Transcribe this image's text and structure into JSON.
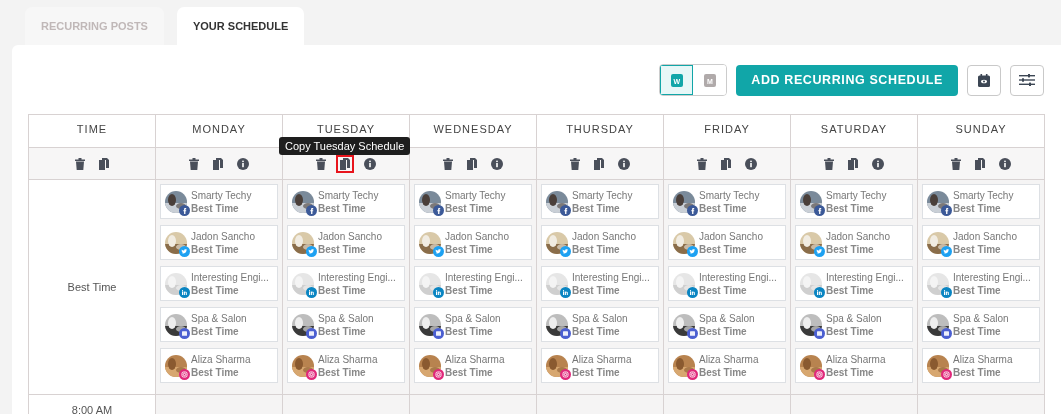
{
  "tabs": [
    {
      "label": "RECURRING POSTS",
      "selected": false
    },
    {
      "label": "YOUR SCHEDULE",
      "selected": true
    }
  ],
  "view_toggle": [
    {
      "label": "W",
      "selected": true
    },
    {
      "label": "M",
      "selected": false
    }
  ],
  "add_button": "ADD RECURRING SCHEDULE",
  "time_header": "TIME",
  "days": [
    {
      "label": "MONDAY",
      "copy_highlighted": false
    },
    {
      "label": "TUESDAY",
      "copy_highlighted": true,
      "tooltip": "Copy Tuesday Schedule"
    },
    {
      "label": "WEDNESDAY",
      "copy_highlighted": false
    },
    {
      "label": "THURSDAY",
      "copy_highlighted": false
    },
    {
      "label": "FRIDAY",
      "copy_highlighted": false
    },
    {
      "label": "SATURDAY",
      "copy_highlighted": false
    },
    {
      "label": "SUNDAY",
      "copy_highlighted": false
    }
  ],
  "rows": [
    {
      "time": "Best Time",
      "cells": [
        [
          {
            "name": "Smarty Techy",
            "kind": "facebook",
            "slot": "Best Time"
          },
          {
            "name": "Jadon Sancho",
            "kind": "twitter",
            "slot": "Best Time"
          },
          {
            "name": "Interesting Engi...",
            "kind": "linkedin",
            "slot": "Best Time"
          },
          {
            "name": "Spa & Salon",
            "kind": "business",
            "slot": "Best Time"
          },
          {
            "name": "Aliza Sharma",
            "kind": "instagram",
            "slot": "Best Time"
          }
        ],
        [
          {
            "name": "Smarty Techy",
            "kind": "facebook",
            "slot": "Best Time"
          },
          {
            "name": "Jadon Sancho",
            "kind": "twitter",
            "slot": "Best Time"
          },
          {
            "name": "Interesting Engi...",
            "kind": "linkedin",
            "slot": "Best Time"
          },
          {
            "name": "Spa & Salon",
            "kind": "business",
            "slot": "Best Time"
          },
          {
            "name": "Aliza Sharma",
            "kind": "instagram",
            "slot": "Best Time"
          }
        ],
        [
          {
            "name": "Smarty Techy",
            "kind": "facebook",
            "slot": "Best Time"
          },
          {
            "name": "Jadon Sancho",
            "kind": "twitter",
            "slot": "Best Time"
          },
          {
            "name": "Interesting Engi...",
            "kind": "linkedin",
            "slot": "Best Time"
          },
          {
            "name": "Spa & Salon",
            "kind": "business",
            "slot": "Best Time"
          },
          {
            "name": "Aliza Sharma",
            "kind": "instagram",
            "slot": "Best Time"
          }
        ],
        [
          {
            "name": "Smarty Techy",
            "kind": "facebook",
            "slot": "Best Time"
          },
          {
            "name": "Jadon Sancho",
            "kind": "twitter",
            "slot": "Best Time"
          },
          {
            "name": "Interesting Engi...",
            "kind": "linkedin",
            "slot": "Best Time"
          },
          {
            "name": "Spa & Salon",
            "kind": "business",
            "slot": "Best Time"
          },
          {
            "name": "Aliza Sharma",
            "kind": "instagram",
            "slot": "Best Time"
          }
        ],
        [
          {
            "name": "Smarty Techy",
            "kind": "facebook",
            "slot": "Best Time"
          },
          {
            "name": "Jadon Sancho",
            "kind": "twitter",
            "slot": "Best Time"
          },
          {
            "name": "Interesting Engi...",
            "kind": "linkedin",
            "slot": "Best Time"
          },
          {
            "name": "Spa & Salon",
            "kind": "business",
            "slot": "Best Time"
          },
          {
            "name": "Aliza Sharma",
            "kind": "instagram",
            "slot": "Best Time"
          }
        ],
        [
          {
            "name": "Smarty Techy",
            "kind": "facebook",
            "slot": "Best Time"
          },
          {
            "name": "Jadon Sancho",
            "kind": "twitter",
            "slot": "Best Time"
          },
          {
            "name": "Interesting Engi...",
            "kind": "linkedin",
            "slot": "Best Time"
          },
          {
            "name": "Spa & Salon",
            "kind": "business",
            "slot": "Best Time"
          },
          {
            "name": "Aliza Sharma",
            "kind": "instagram",
            "slot": "Best Time"
          }
        ],
        [
          {
            "name": "Smarty Techy",
            "kind": "facebook",
            "slot": "Best Time"
          },
          {
            "name": "Jadon Sancho",
            "kind": "twitter",
            "slot": "Best Time"
          },
          {
            "name": "Interesting Engi...",
            "kind": "linkedin",
            "slot": "Best Time"
          },
          {
            "name": "Spa & Salon",
            "kind": "business",
            "slot": "Best Time"
          },
          {
            "name": "Aliza Sharma",
            "kind": "instagram",
            "slot": "Best Time"
          }
        ]
      ]
    },
    {
      "time": "8:00 AM"
    }
  ]
}
